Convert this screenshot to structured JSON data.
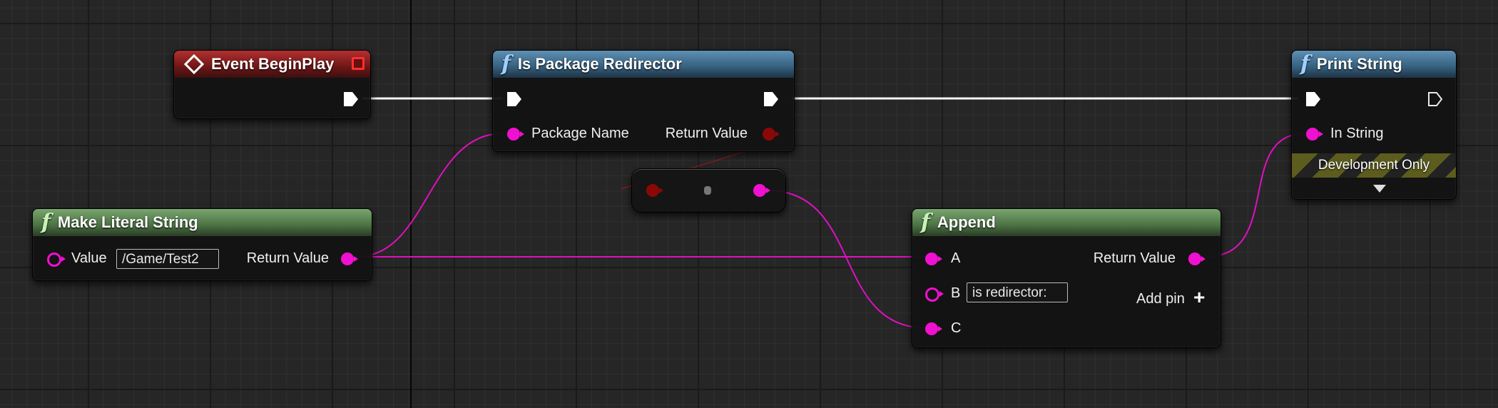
{
  "graph": {
    "colors": {
      "event_header": "#8a1e1e",
      "function_header": "#4a7898",
      "pure_function_header": "#5b8a52",
      "string_pin": "#f010d0",
      "exec_pin": "#ffffff",
      "bool_pin": "#8a0808"
    },
    "nodes": {
      "event_begin_play": {
        "title": "Event BeginPlay",
        "icon": "event-diamond-icon"
      },
      "is_package_redirector": {
        "title": "Is Package Redirector",
        "icon": "function-icon",
        "input_label": "Package Name",
        "output_label": "Return Value"
      },
      "print_string": {
        "title": "Print String",
        "icon": "function-icon",
        "input_label": "In String",
        "dev_only_label": "Development Only"
      },
      "make_literal_string": {
        "title": "Make Literal String",
        "icon": "function-icon",
        "input_label": "Value",
        "input_value": "/Game/Test2",
        "output_label": "Return Value"
      },
      "append": {
        "title": "Append",
        "icon": "function-icon",
        "pin_a_label": "A",
        "pin_b_label": "B",
        "pin_b_value": "is redirector:",
        "pin_c_label": "C",
        "output_label": "Return Value",
        "add_pin_label": "Add pin"
      }
    }
  }
}
